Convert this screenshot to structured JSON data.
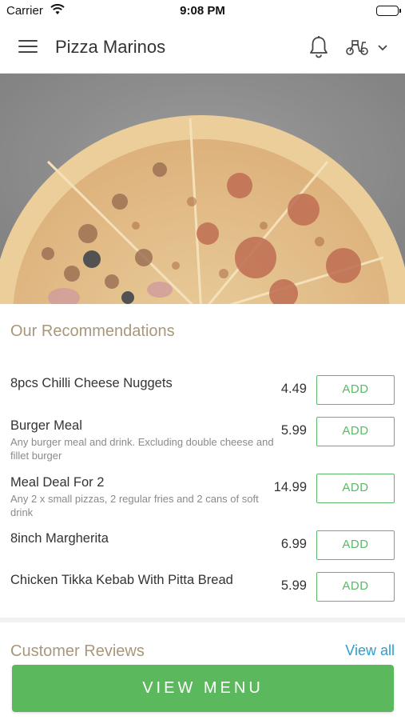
{
  "status_bar": {
    "carrier": "Carrier",
    "time": "9:08 PM"
  },
  "header": {
    "title": "Pizza Marinos",
    "menu_icon": "hamburger-menu-icon",
    "bell_icon": "bell-icon",
    "delivery_icon": "scooter-icon",
    "dropdown_icon": "chevron-down-icon"
  },
  "recommendations": {
    "title": "Our Recommendations",
    "items": [
      {
        "name": "8pcs Chilli Cheese Nuggets",
        "description": "",
        "price": "4.49",
        "add_label": "ADD"
      },
      {
        "name": "Burger Meal",
        "description": "Any burger meal and drink. Excluding double cheese and fillet burger",
        "price": "5.99",
        "add_label": "ADD"
      },
      {
        "name": "Meal Deal For 2",
        "description": "Any 2 x small pizzas, 2 regular fries and 2 cans of soft drink",
        "price": "14.99",
        "add_label": "ADD"
      },
      {
        "name": "8inch Margherita",
        "description": "",
        "price": "6.99",
        "add_label": "ADD"
      },
      {
        "name": "Chicken Tikka Kebab With Pitta Bread",
        "description": "",
        "price": "5.99",
        "add_label": "ADD"
      }
    ]
  },
  "reviews": {
    "title": "Customer Reviews",
    "view_all": "View all"
  },
  "footer": {
    "view_menu_label": "VIEW MENU"
  },
  "colors": {
    "accent_green": "#5cb85c",
    "section_title": "#a8977a",
    "link_blue": "#2a9fd0"
  }
}
